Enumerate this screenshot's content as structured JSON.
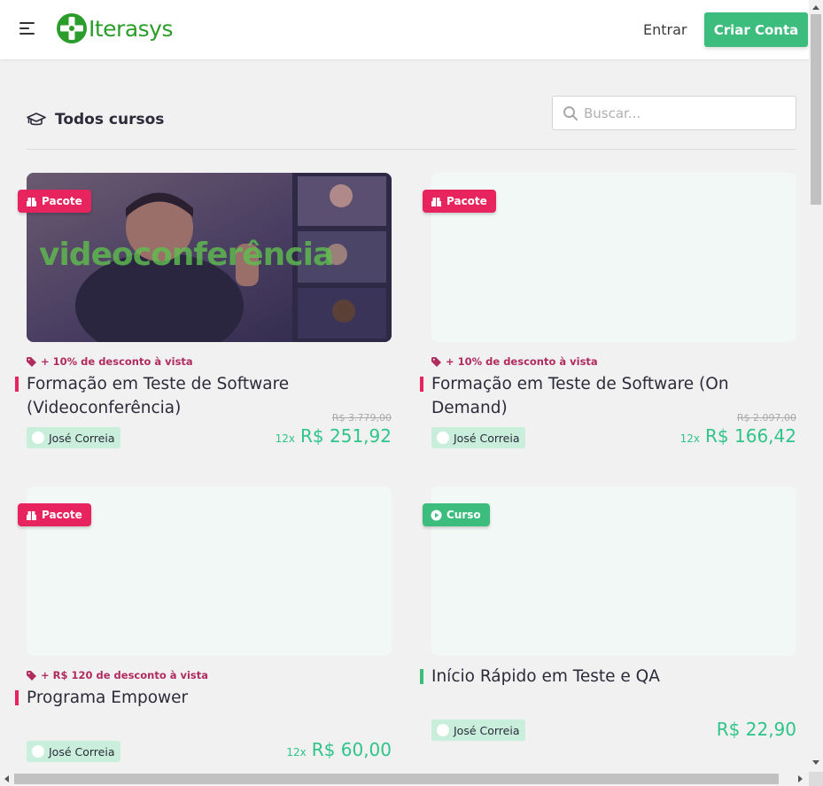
{
  "header": {
    "logo_text": "Iterasys",
    "login_label": "Entrar",
    "signup_label": "Criar Conta"
  },
  "section": {
    "title": "Todos cursos",
    "search_placeholder": "Buscar..."
  },
  "courses": [
    {
      "badge": "Pacote",
      "badge_color": "#e8245f",
      "thumbnail_text": "videoconferência",
      "discount": "+ 10% de desconto à vista",
      "title": "Formação em Teste de Software (Videoconferência)",
      "author": "José Correia",
      "old_price": "R$ 3.779,00",
      "installments": "12x",
      "price": "R$ 251,92"
    },
    {
      "badge": "Pacote",
      "badge_color": "#e8245f",
      "discount": "+ 10% de desconto à vista",
      "title": "Formação em Teste de Software (On Demand)",
      "author": "José Correia",
      "old_price": "R$ 2.097,00",
      "installments": "12x",
      "price": "R$ 166,42"
    },
    {
      "badge": "Pacote",
      "badge_color": "#e8245f",
      "discount": "+ R$ 120 de desconto à vista",
      "title": "Programa Empower",
      "author": "José Correia",
      "installments": "12x",
      "price": "R$ 60,00"
    },
    {
      "badge": "Curso",
      "badge_color": "#3dbd7d",
      "title": "Início Rápido em Teste e QA",
      "author": "José Correia",
      "price": "R$ 22,90"
    }
  ]
}
